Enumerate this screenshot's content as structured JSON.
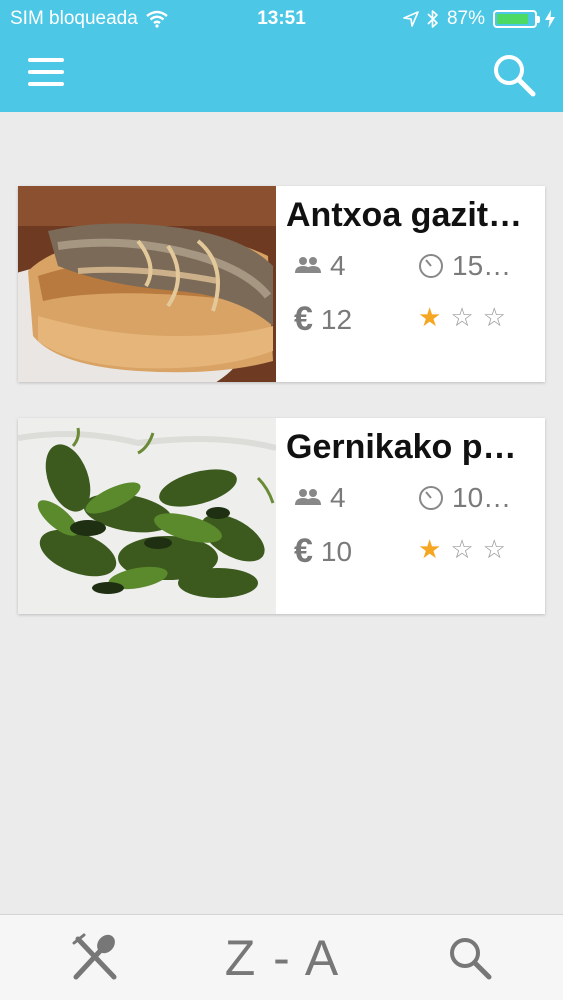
{
  "status_bar": {
    "carrier": "SIM bloqueada",
    "time": "13:51",
    "battery": "87%",
    "battery_fraction": 0.87,
    "battery_color": "#4cd964"
  },
  "nav": {
    "accent": "#4cc8e6",
    "menu_icon": "hamburger-icon",
    "search_icon": "search-icon"
  },
  "recipes": [
    {
      "title": "Antxoa gazit…",
      "people": "4",
      "time": "15…",
      "price": "12",
      "currency": "€",
      "rating": 1,
      "rating_max": 3
    },
    {
      "title": "Gernikako p…",
      "people": "4",
      "time": "10…",
      "price": "10",
      "currency": "€",
      "rating": 1,
      "rating_max": 3
    }
  ],
  "tabbar": {
    "tab_recipes_icon": "fork-spoon-icon",
    "tab_sort_label": "Z - A",
    "tab_search_icon": "search-icon"
  }
}
